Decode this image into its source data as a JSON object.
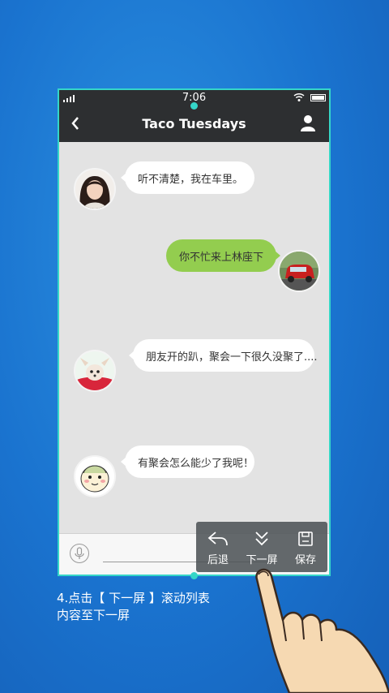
{
  "status_bar": {
    "time": "7:06"
  },
  "header": {
    "title": "Taco Tuesdays"
  },
  "messages": [
    {
      "side": "left",
      "avatar": "woman-avatar",
      "text": "听不清楚，我在车里。"
    },
    {
      "side": "right",
      "avatar": "red-car-avatar",
      "text": "你不忙来上林座下"
    },
    {
      "side": "left",
      "avatar": "puppy-avatar",
      "text": "朋友开的趴，聚会一下很久没聚了...."
    },
    {
      "side": "left",
      "avatar": "cartoon-face-avatar",
      "text": "有聚会怎么能少了我呢！"
    }
  ],
  "toolbar": {
    "back_label": "后退",
    "next_screen_label": "下一屏",
    "save_label": "保存"
  },
  "caption": {
    "line1": "4.点击【 下一屏 】滚动列表",
    "line2": "内容至下一屏"
  },
  "colors": {
    "background": "#1a73cf",
    "bar": "#2d2f31",
    "selection": "#35d6c8",
    "bubble_right": "#93cd4f",
    "bubble_left": "#ffffff"
  }
}
